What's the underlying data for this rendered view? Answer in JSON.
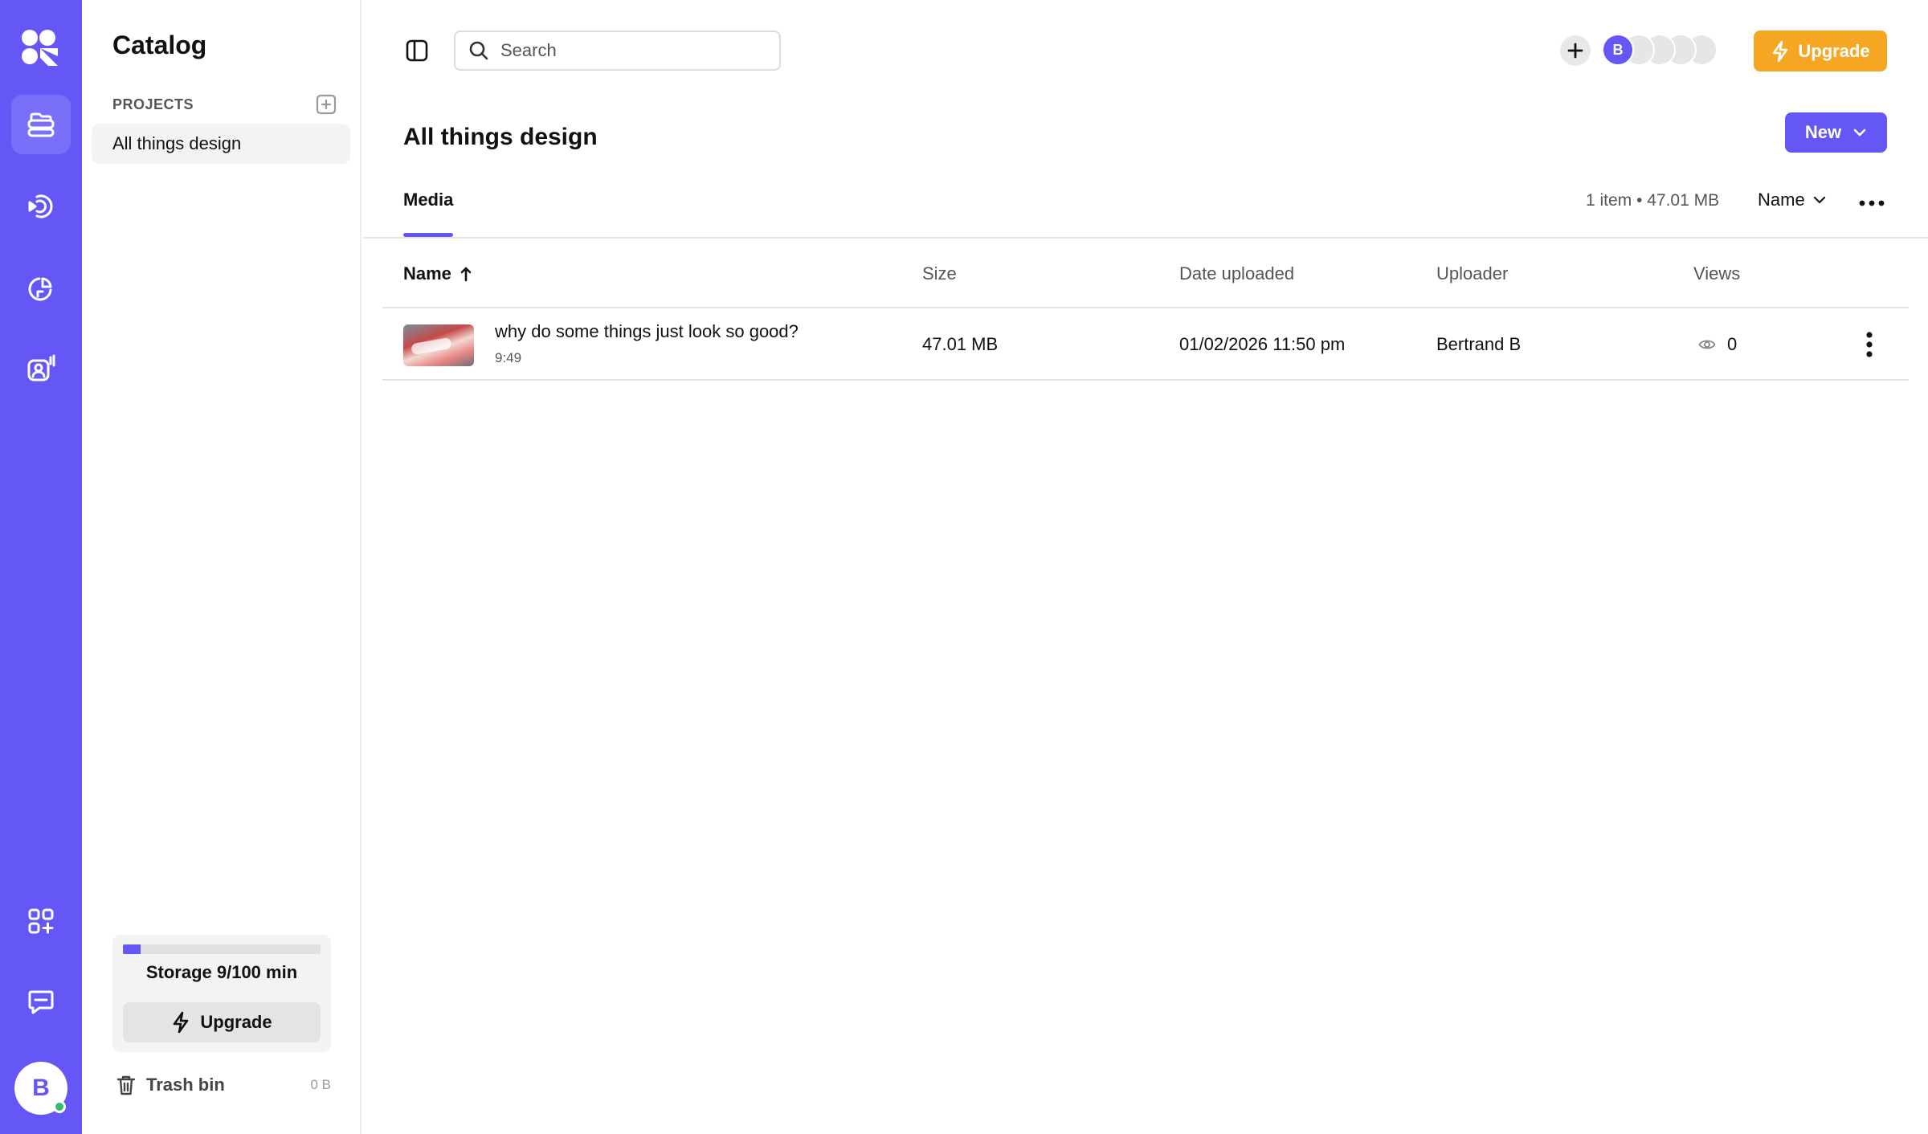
{
  "rail": {
    "nav": [
      {
        "name": "library",
        "active": true
      },
      {
        "name": "broadcast",
        "active": false
      },
      {
        "name": "analytics",
        "active": false
      },
      {
        "name": "studio",
        "active": false
      }
    ],
    "bottom": [
      "apps",
      "chat"
    ],
    "avatar_initial": "B"
  },
  "catalog": {
    "title": "Catalog",
    "projects_label": "PROJECTS",
    "projects": [
      "All things design"
    ],
    "storage": {
      "label": "Storage 9/100 min",
      "used_fraction": 0.09
    },
    "upgrade_label": "Upgrade",
    "trash_label": "Trash bin",
    "trash_size": "0 B"
  },
  "header": {
    "search_placeholder": "Search",
    "member_initial": "B",
    "upgrade_label": "Upgrade"
  },
  "page": {
    "title": "All things design",
    "new_label": "New",
    "tabs": [
      {
        "label": "Media",
        "active": true
      }
    ],
    "summary": "1 item • 47.01 MB",
    "sort_label": "Name"
  },
  "table": {
    "columns": {
      "name": "Name",
      "size": "Size",
      "date": "Date uploaded",
      "uploader": "Uploader",
      "views": "Views"
    },
    "rows": [
      {
        "title": "why do some things just look so good?",
        "duration": "9:49",
        "size": "47.01 MB",
        "date": "01/02/2026 11:50 pm",
        "uploader": "Bertrand B",
        "views": "0"
      }
    ]
  },
  "colors": {
    "accent": "#6457f5",
    "upgrade": "#f5a623",
    "online": "#2fbf6a"
  }
}
